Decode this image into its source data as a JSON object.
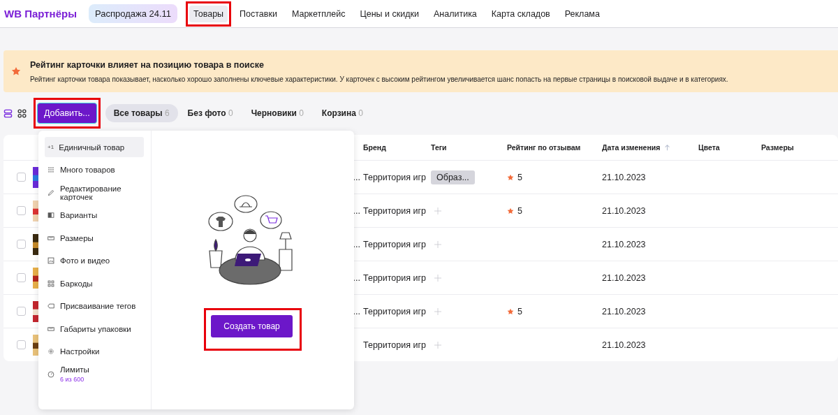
{
  "header": {
    "logo": "WB Партнёры",
    "promo": "Распродажа 24.11",
    "nav": [
      {
        "label": "Товары",
        "selected": true,
        "highlighted": true
      },
      {
        "label": "Поставки",
        "selected": false,
        "highlighted": false
      },
      {
        "label": "Маркетплейс",
        "selected": false,
        "highlighted": false
      },
      {
        "label": "Цены и скидки",
        "selected": false,
        "highlighted": false
      },
      {
        "label": "Аналитика",
        "selected": false,
        "highlighted": false
      },
      {
        "label": "Карта складов",
        "selected": false,
        "highlighted": false
      },
      {
        "label": "Реклама",
        "selected": false,
        "highlighted": false
      }
    ]
  },
  "banner": {
    "title": "Рейтинг карточки влияет на позицию товара в поиске",
    "text": "Рейтинг карточки товара показывает, насколько хорошо заполнены ключевые характеристики. У карточек с высоким рейтингом увеличивается шанс попасть на первые страницы в поисковой выдаче и в категориях."
  },
  "toolbar": {
    "view_modes": [
      {
        "kind": "list",
        "selected": true
      },
      {
        "kind": "grid",
        "selected": false
      }
    ],
    "add_button": {
      "label": "Добавить...",
      "highlighted": true
    },
    "tabs": [
      {
        "label": "Все товары",
        "count": "6",
        "selected": true
      },
      {
        "label": "Без фото",
        "count": "0",
        "selected": false
      },
      {
        "label": "Черновики",
        "count": "0",
        "selected": false
      },
      {
        "label": "Корзина",
        "count": "0",
        "selected": false
      }
    ]
  },
  "table": {
    "columns": [
      "Бренд",
      "Теги",
      "Рейтинг по отзывам",
      "Дата изменения",
      "Цвета",
      "Размеры"
    ],
    "rows": [
      {
        "checked": false,
        "tail": "...",
        "brand": "Территория игр",
        "tag": "Образ...",
        "rating": "5",
        "date": "21.10.2023"
      },
      {
        "checked": false,
        "tail": "...",
        "brand": "Территория игр",
        "rating": "5",
        "date": "21.10.2023"
      },
      {
        "checked": false,
        "tail": "...",
        "brand": "Территория игр",
        "date": "21.10.2023"
      },
      {
        "checked": false,
        "tail": "...",
        "brand": "Территория игр",
        "date": "21.10.2023"
      },
      {
        "checked": false,
        "tail": "...",
        "brand": "Территория игр",
        "rating": "5",
        "date": "21.10.2023"
      },
      {
        "checked": false,
        "brand": "Территория игр",
        "date": "21.10.2023"
      }
    ]
  },
  "add_menu": {
    "items": [
      {
        "kind": "single",
        "icon_text": "+1",
        "label": "Единичный товар",
        "selected": true
      },
      {
        "kind": "many",
        "label": "Много товаров",
        "selected": false
      },
      {
        "kind": "edit",
        "label": "Редактирование карточек",
        "selected": false
      },
      {
        "kind": "variants",
        "label": "Варианты",
        "selected": false
      },
      {
        "kind": "sizes",
        "label": "Размеры",
        "selected": false
      },
      {
        "kind": "media",
        "label": "Фото и видео",
        "selected": false
      },
      {
        "kind": "barcodes",
        "label": "Баркоды",
        "selected": false
      },
      {
        "kind": "tags",
        "label": "Присваивание тегов",
        "selected": false
      },
      {
        "kind": "package",
        "label": "Габариты упаковки",
        "selected": false
      },
      {
        "kind": "settings",
        "label": "Настройки",
        "selected": false
      },
      {
        "kind": "limits",
        "label": "Лимиты",
        "sub": "6 из 600",
        "selected": false
      }
    ],
    "create_button": {
      "label": "Создать товар",
      "highlighted": true
    }
  }
}
